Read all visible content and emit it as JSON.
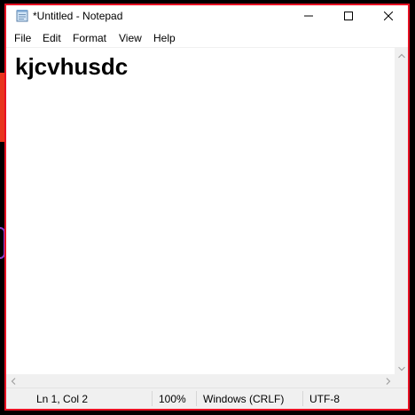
{
  "window": {
    "title": "*Untitled - Notepad",
    "border_color": "#e81123"
  },
  "titlebar_buttons": {
    "minimize_icon": "minimize-icon",
    "maximize_icon": "maximize-icon",
    "close_icon": "close-icon"
  },
  "menu": {
    "items": [
      "File",
      "Edit",
      "Format",
      "View",
      "Help"
    ]
  },
  "editor": {
    "content": "kjcvhusdc"
  },
  "statusbar": {
    "position": "Ln 1, Col 2",
    "zoom": "100%",
    "line_ending": "Windows (CRLF)",
    "encoding": "UTF-8"
  }
}
